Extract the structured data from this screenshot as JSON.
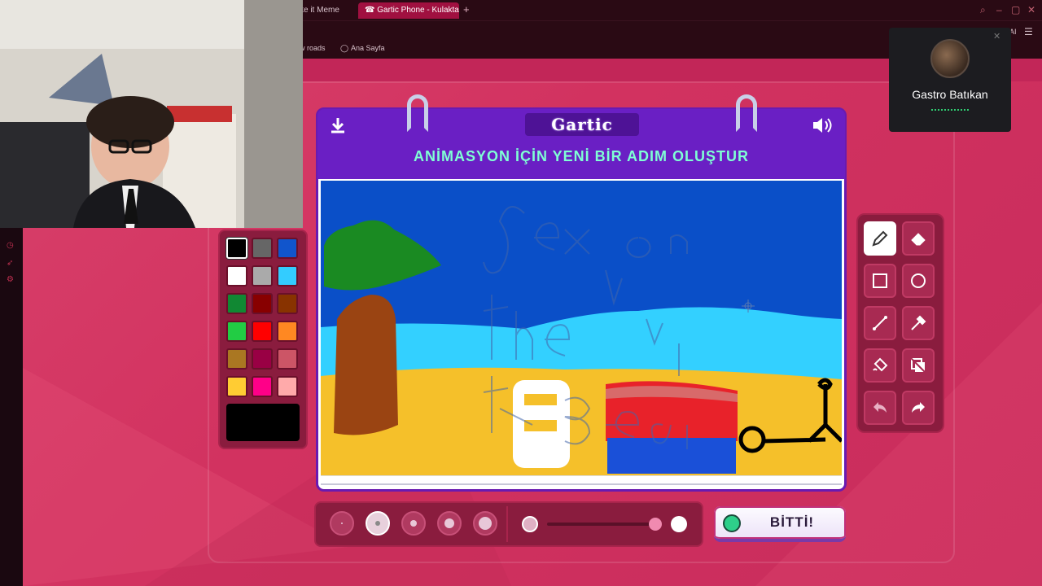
{
  "browser": {
    "tabs": [
      {
        "label": "ke it Meme",
        "active": false
      },
      {
        "label": "☎ Gartic Phone - Kulaktan K",
        "active": true
      }
    ],
    "bookmarks": [
      "w roads",
      "Ana Sayfa"
    ],
    "ai_label": "AI"
  },
  "game": {
    "logo": "Gartic",
    "title": "ANİMASYON İÇİN YENİ BİR ADIM OLUŞTUR",
    "done_label": "BİTTİ!",
    "palette_colors": [
      "#000000",
      "#666666",
      "#1155cc",
      "#ffffff",
      "#aaaaaa",
      "#33ccff",
      "#118833",
      "#880000",
      "#883300",
      "#22cc44",
      "#ff0000",
      "#ff8822",
      "#aa7722",
      "#990044",
      "#cc5566",
      "#ffcc33",
      "#ff0088",
      "#ffaaaa"
    ],
    "selected_color": "#000000",
    "tools": [
      "pencil-icon",
      "eraser-icon",
      "rectangle-icon",
      "ellipse-icon",
      "line-icon",
      "eyedropper-icon",
      "fill-icon",
      "layers-icon",
      "undo-icon",
      "redo-icon"
    ],
    "canvas_text": {
      "line1": "Sex on",
      "line2": "the",
      "line3": "the Beach"
    }
  },
  "call": {
    "name": "Gastro Batıkan"
  },
  "colors": {
    "accent_purple": "#6a1fc4",
    "heading_teal": "#7fffd4",
    "bg_pink": "#d23260"
  }
}
